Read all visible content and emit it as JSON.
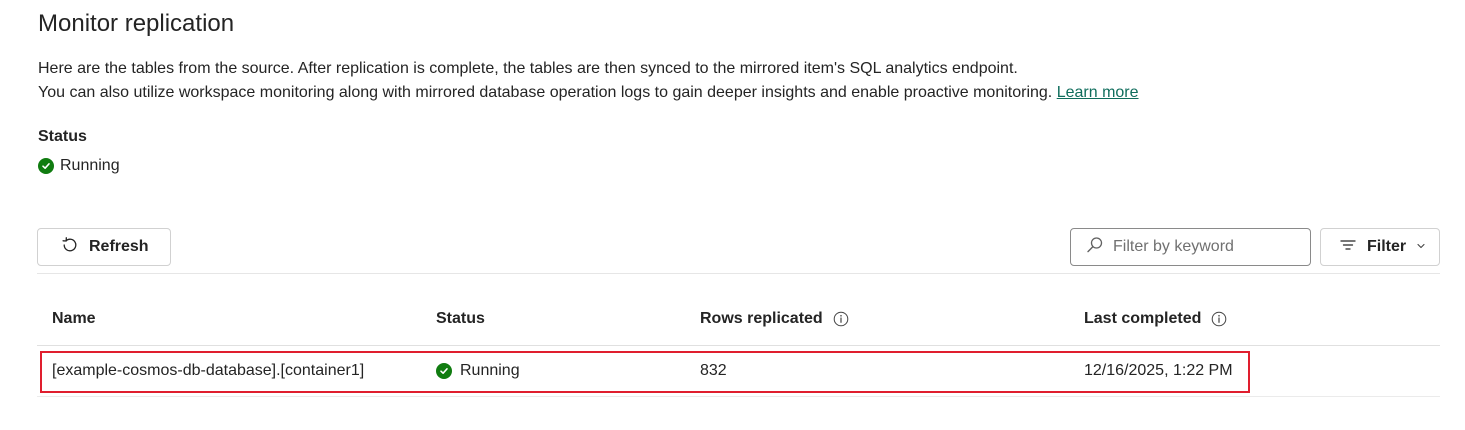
{
  "page": {
    "title": "Monitor replication",
    "description_line1": "Here are the tables from the source. After replication is complete, the tables are then synced to the mirrored item's SQL analytics endpoint.",
    "description_line2": "You can also utilize workspace monitoring along with mirrored database operation logs to gain deeper insights and enable proactive monitoring.",
    "learn_more": "Learn more"
  },
  "status": {
    "label": "Status",
    "value": "Running",
    "icon": "check-circle-icon",
    "color": "#107c10"
  },
  "toolbar": {
    "refresh_label": "Refresh",
    "refresh_icon": "refresh-icon",
    "search_placeholder": "Filter by keyword",
    "search_value": "",
    "search_icon": "search-icon",
    "filter_label": "Filter",
    "filter_icon": "filter-lines-icon"
  },
  "table": {
    "columns": [
      "Name",
      "Status",
      "Rows replicated",
      "Last completed"
    ],
    "rows": [
      {
        "name": "[example-cosmos-db-database].[container1]",
        "status": "Running",
        "rows_replicated": "832",
        "last_completed": "12/16/2025, 1:22 PM"
      }
    ]
  },
  "colors": {
    "link": "#0f6d5c",
    "success": "#107c10",
    "highlight": "#e01e2e"
  }
}
